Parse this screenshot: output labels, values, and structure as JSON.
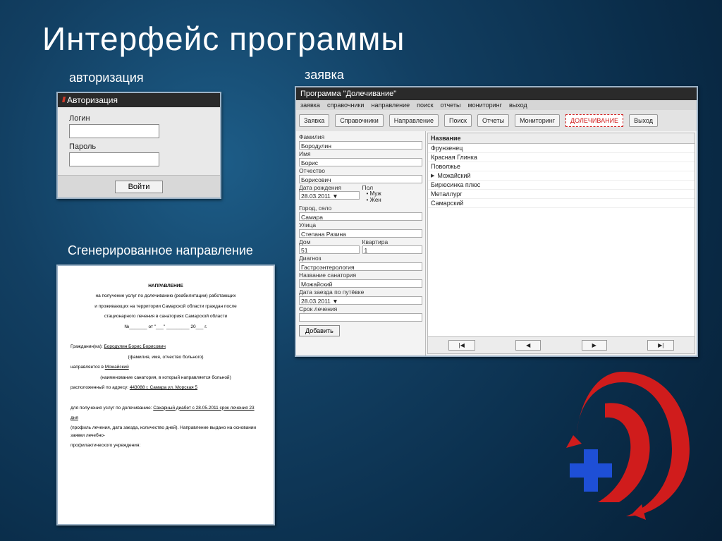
{
  "slide": {
    "title": "Интерфейс программы",
    "caption_auth": "авторизация",
    "caption_request": "заявка",
    "caption_doc": "Сгенерированное направление"
  },
  "auth": {
    "window_title": "Авторизация",
    "login_label": "Логин",
    "password_label": "Пароль",
    "submit": "Войти"
  },
  "app": {
    "window_title": "Программа \"Долечивание\"",
    "menu": [
      "заявка",
      "справочники",
      "направление",
      "поиск",
      "отчеты",
      "мониторинг",
      "выход"
    ],
    "toolbar": {
      "request": "Заявка",
      "refs": "Справочники",
      "direction": "Направление",
      "search": "Поиск",
      "reports": "Отчеты",
      "monitoring": "Мониторинг",
      "highlight": "ДОЛЕЧИВАНИЕ",
      "exit": "Выход"
    },
    "form": {
      "surname_label": "Фамилия",
      "surname": "Бородулин",
      "name_label": "Имя",
      "name": "Борис",
      "patronymic_label": "Отчество",
      "patronymic": "Борисович",
      "dob_label": "Дата рождения",
      "dob": "28.03.2011",
      "gender_label": "Пол",
      "gender_m": "Муж",
      "gender_f": "Жен",
      "city_label": "Город, село",
      "city": "Самара",
      "street_label": "Улица",
      "street": "Степана Разина",
      "house_label": "Дом",
      "house": "51",
      "flat_label": "Квартира",
      "flat": "1",
      "diag_label": "Диагноз",
      "diag": "Гастроэнтерология",
      "san_label": "Название санатория",
      "san": "Можайский",
      "arrive_label": "Дата заезда по путёвке",
      "arrive": "28.03.2011",
      "term_label": "Срок лечения",
      "add_btn": "Добавить"
    },
    "list": {
      "header": "Название",
      "items": [
        {
          "name": "Фрунзенец",
          "selected": false
        },
        {
          "name": "Красная Глинка",
          "selected": false
        },
        {
          "name": "Поволжье",
          "selected": false
        },
        {
          "name": "Можайский",
          "selected": true
        },
        {
          "name": "Бирюсинка плюс",
          "selected": false
        },
        {
          "name": "Металлург",
          "selected": false
        },
        {
          "name": "Самарский",
          "selected": false
        }
      ]
    },
    "nav": {
      "first": "|◀",
      "prev": "◀",
      "next": "▶",
      "last": "▶|"
    }
  },
  "doc": {
    "title": "НАПРАВЛЕНИЕ",
    "sub1": "на получение услуг по долечиванию (реабилитации) работающих",
    "sub2": "и проживающих на территории Самарской области граждан после",
    "sub3": "стационарного лечения в санаториях Самарской области",
    "numline": "№_______ от \"___\" _________ 20___ г.",
    "citizen_lbl": "Гражданин(ка):",
    "citizen": "Бородулин Борис Борисович",
    "citizen_note": "(фамилия, имя, отчество больного)",
    "sent_lbl": "направляется в",
    "sanatorium": "Можайский",
    "san_note": "(наименование санатория, в который направляется больной)",
    "addr_lbl": "расположенный по адресу:",
    "addr": "443088 г. Самара ул. Морская 5",
    "serv_lbl": "для получения услуг по долечиванию:",
    "diag": "Сахарный диабет с 28.05.2011   срок лечения  23",
    "days": "дня",
    "foot": "(профиль лечения, дата заезда, количество дней).  Направление выдано на основании      заявки лечебно-",
    "foot2": "профилактического учреждения:"
  }
}
